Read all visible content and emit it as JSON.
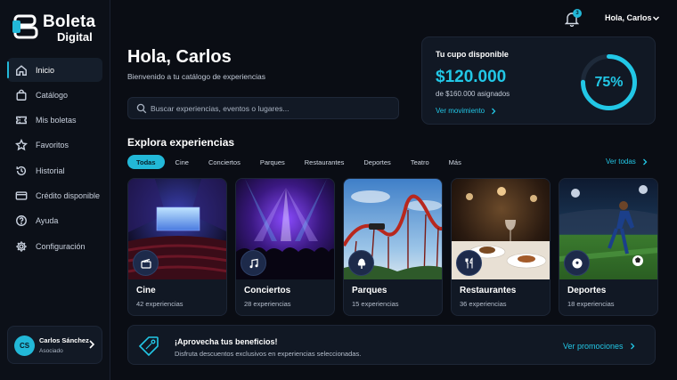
{
  "brand": {
    "line1": "Boleta",
    "line2": "Digital"
  },
  "topbar": {
    "notification_count": "3",
    "greeting": "Hola, Carlos"
  },
  "sidebar": {
    "items": [
      {
        "label": "Inicio",
        "icon": "home-icon",
        "active": true
      },
      {
        "label": "Catálogo",
        "icon": "bag-icon",
        "active": false
      },
      {
        "label": "Mis boletas",
        "icon": "ticket-icon",
        "active": false
      },
      {
        "label": "Favoritos",
        "icon": "star-icon",
        "active": false
      },
      {
        "label": "Historial",
        "icon": "history-icon",
        "active": false
      },
      {
        "label": "Crédito disponible",
        "icon": "credit-card-icon",
        "active": false
      },
      {
        "label": "Ayuda",
        "icon": "help-icon",
        "active": false
      },
      {
        "label": "Configuración",
        "icon": "gear-icon",
        "active": false
      }
    ],
    "user": {
      "initials": "CS",
      "name": "Carlos Sánchez",
      "role": "Asociado"
    }
  },
  "hero": {
    "title": "Hola, Carlos",
    "subtitle": "Bienvenido a tu catálogo de experiencias"
  },
  "search": {
    "placeholder": "Buscar experiencias, eventos o lugares..."
  },
  "cupo": {
    "title": "Tu cupo disponible",
    "amount": "$120.000",
    "assigned": "de $160.000 asignados",
    "link": "Ver movimiento",
    "percent_label": "75%",
    "percent": 0.75
  },
  "explore": {
    "title": "Explora experiencias",
    "filters": [
      "Todas",
      "Cine",
      "Conciertos",
      "Parques",
      "Restaurantes",
      "Deportes",
      "Teatro",
      "Más"
    ],
    "active_filter": "Todas",
    "see_all": "Ver todas"
  },
  "categories": [
    {
      "title": "Cine",
      "count": "42 experiencias",
      "icon": "clapperboard-icon"
    },
    {
      "title": "Conciertos",
      "count": "28 experiencias",
      "icon": "music-note-icon"
    },
    {
      "title": "Parques",
      "count": "15 experiencias",
      "icon": "tree-icon"
    },
    {
      "title": "Restaurantes",
      "count": "36 experiencias",
      "icon": "fork-knife-icon"
    },
    {
      "title": "Deportes",
      "count": "18 experiencias",
      "icon": "soccer-ball-icon"
    }
  ],
  "promo": {
    "title": "¡Aprovecha tus beneficios!",
    "subtitle": "Disfruta descuentos exclusivos en experiencias seleccionadas.",
    "link": "Ver promociones"
  },
  "colors": {
    "accent": "#22c7e6",
    "background": "#0a0d14",
    "card": "#111824"
  }
}
